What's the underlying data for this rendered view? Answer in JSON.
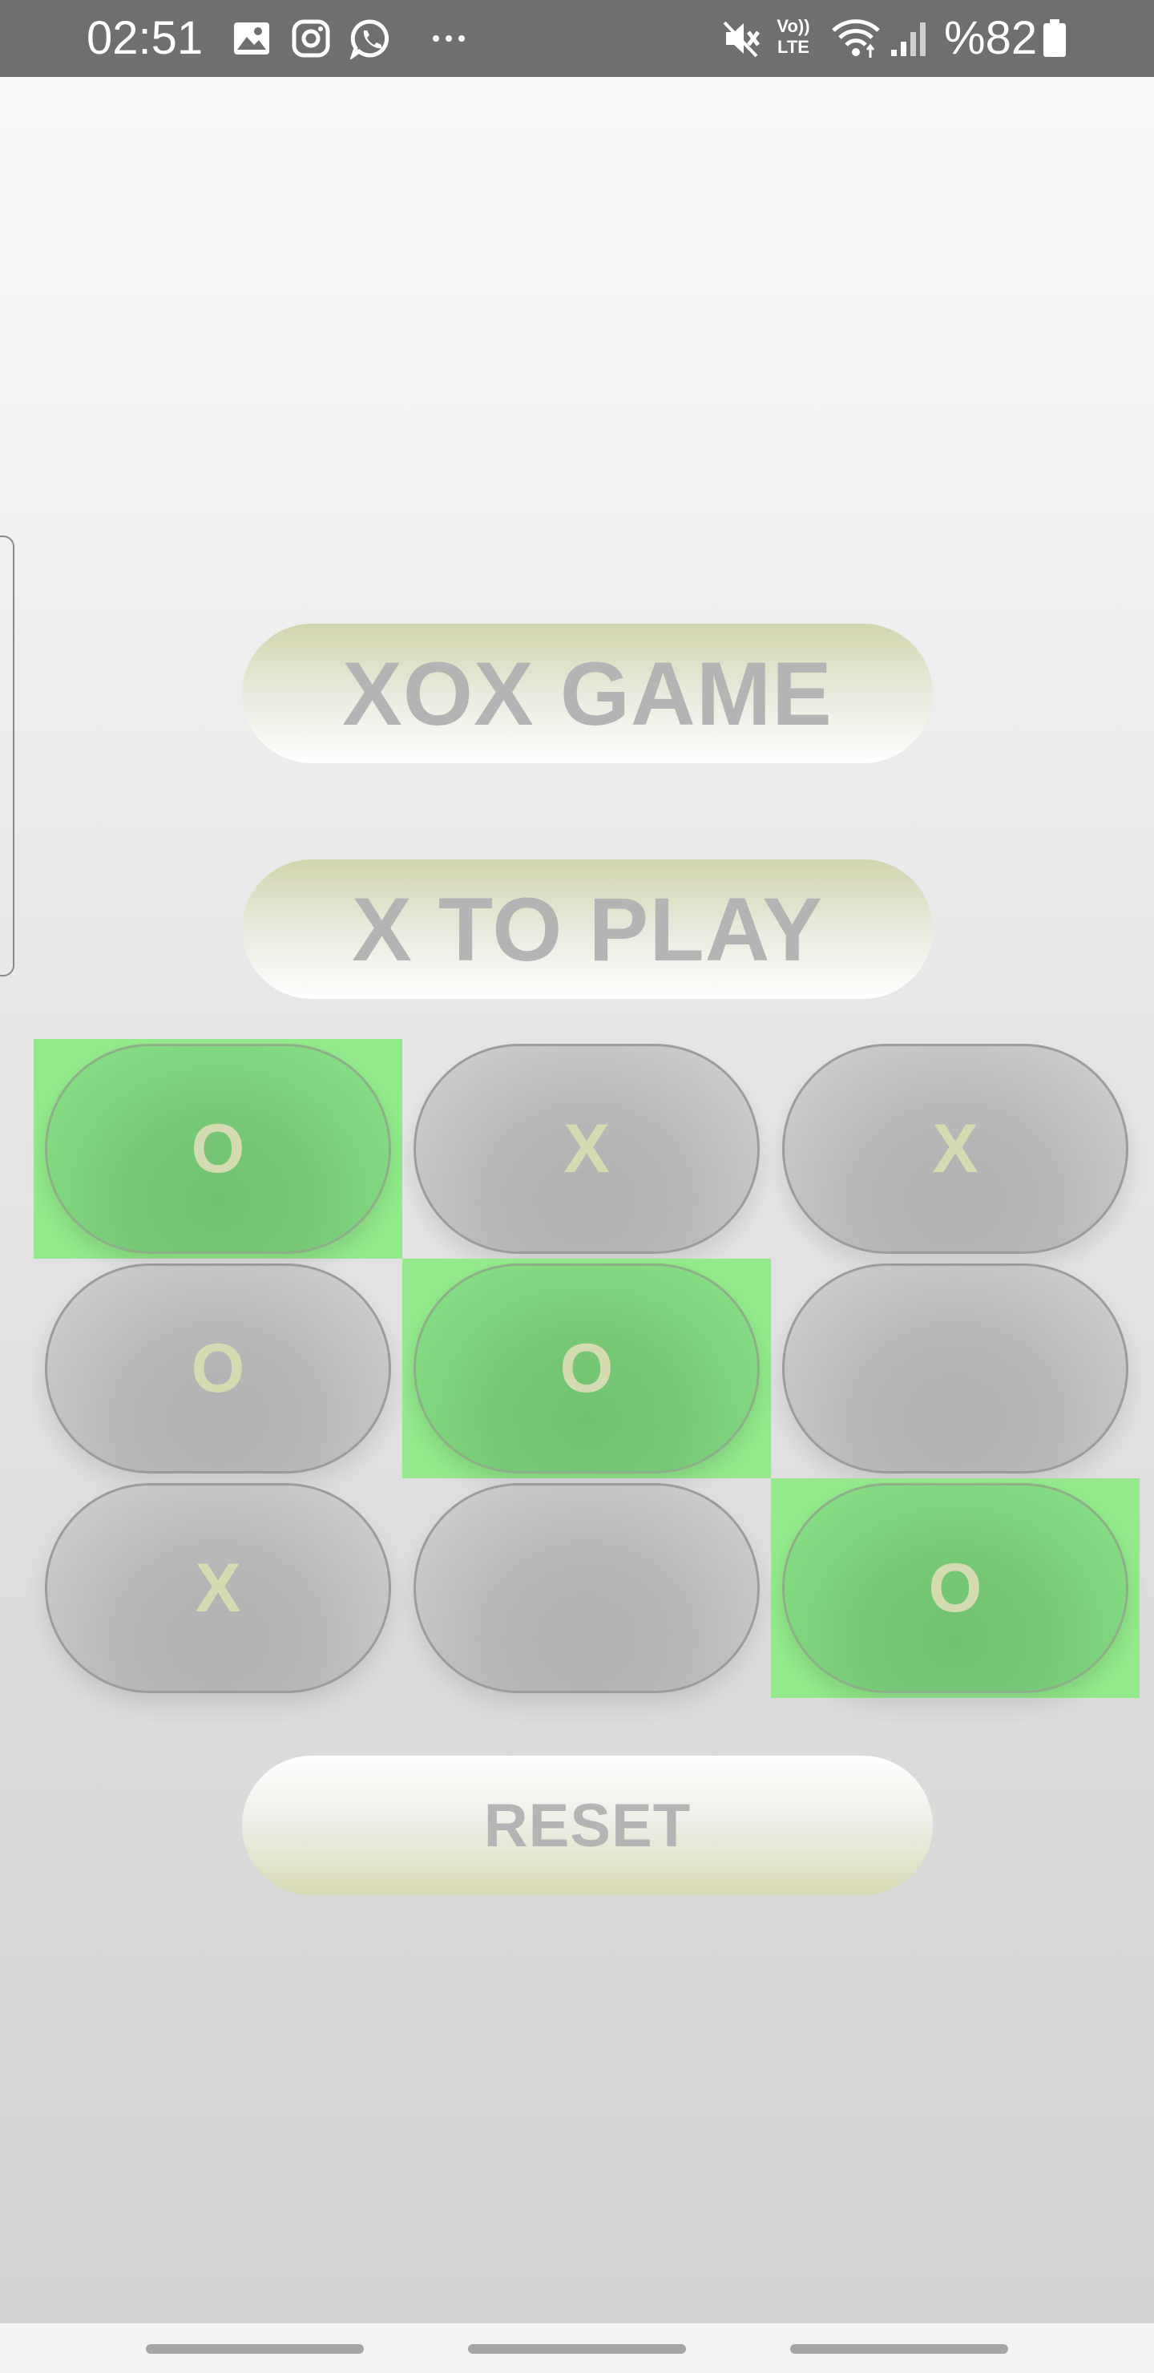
{
  "status_bar": {
    "time": "02:51",
    "battery_percent": "%82",
    "icons": [
      "gallery-icon",
      "instagram-icon",
      "whatsapp-icon",
      "more-icon",
      "mute-icon",
      "volte-icon",
      "wifi-icon",
      "signal-icon",
      "battery-icon"
    ],
    "volte_text_top": "Vo))",
    "volte_text_bottom": "LTE"
  },
  "game": {
    "title": "XOX GAME",
    "turn_status": "X TO PLAY",
    "reset_label": "RESET",
    "board": [
      [
        "O",
        "X",
        "X"
      ],
      [
        "O",
        "O",
        ""
      ],
      [
        "X",
        "",
        "O"
      ]
    ],
    "winning_cells": [
      [
        0,
        0
      ],
      [
        1,
        1
      ],
      [
        2,
        2
      ]
    ]
  },
  "colors": {
    "status_bar_bg": "#6f6f6f",
    "win_highlight": "#93e98b",
    "cell_text": "#d4dbb0",
    "pill_text": "#b4b4b4"
  }
}
